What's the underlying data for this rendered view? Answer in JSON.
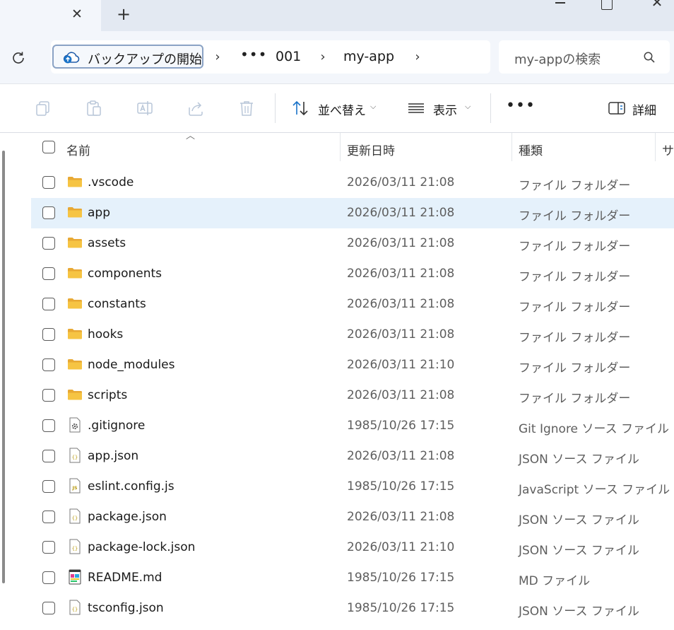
{
  "titlebar": {
    "tab_close_glyph": "✕",
    "new_tab_glyph": "+"
  },
  "address": {
    "root_label": "バックアップの開始",
    "breadcrumb": [
      "001",
      "my-app"
    ],
    "search_placeholder": "my-appの検索"
  },
  "commands": {
    "sort_label": "並べ替え",
    "view_label": "表示",
    "details_label": "詳細",
    "icons": [
      "copy-icon",
      "paste-icon",
      "rename-icon",
      "share-icon",
      "delete-icon"
    ]
  },
  "columns": {
    "name": "名前",
    "date": "更新日時",
    "type": "種類",
    "size": "サイズ"
  },
  "files": [
    {
      "name": ".vscode",
      "date": "2026/03/11 21:08",
      "type": "ファイル フォルダー",
      "icon": "folder-icon"
    },
    {
      "name": "app",
      "date": "2026/03/11 21:08",
      "type": "ファイル フォルダー",
      "icon": "folder-icon",
      "selected": true
    },
    {
      "name": "assets",
      "date": "2026/03/11 21:08",
      "type": "ファイル フォルダー",
      "icon": "folder-icon"
    },
    {
      "name": "components",
      "date": "2026/03/11 21:08",
      "type": "ファイル フォルダー",
      "icon": "folder-icon"
    },
    {
      "name": "constants",
      "date": "2026/03/11 21:08",
      "type": "ファイル フォルダー",
      "icon": "folder-icon"
    },
    {
      "name": "hooks",
      "date": "2026/03/11 21:08",
      "type": "ファイル フォルダー",
      "icon": "folder-icon"
    },
    {
      "name": "node_modules",
      "date": "2026/03/11 21:10",
      "type": "ファイル フォルダー",
      "icon": "folder-icon"
    },
    {
      "name": "scripts",
      "date": "2026/03/11 21:08",
      "type": "ファイル フォルダー",
      "icon": "folder-icon"
    },
    {
      "name": ".gitignore",
      "date": "1985/10/26 17:15",
      "type": "Git Ignore ソース ファイル",
      "icon": "gear-file-icon"
    },
    {
      "name": "app.json",
      "date": "2026/03/11 21:08",
      "type": "JSON ソース ファイル",
      "icon": "json-file-icon"
    },
    {
      "name": "eslint.config.js",
      "date": "1985/10/26 17:15",
      "type": "JavaScript ソース ファイル",
      "icon": "js-file-icon"
    },
    {
      "name": "package.json",
      "date": "2026/03/11 21:08",
      "type": "JSON ソース ファイル",
      "icon": "json-file-icon"
    },
    {
      "name": "package-lock.json",
      "date": "2026/03/11 21:10",
      "type": "JSON ソース ファイル",
      "icon": "json-file-icon"
    },
    {
      "name": "README.md",
      "date": "1985/10/26 17:15",
      "type": "MD ファイル",
      "icon": "markdown-file-icon"
    },
    {
      "name": "tsconfig.json",
      "date": "1985/10/26 17:15",
      "type": "JSON ソース ファイル",
      "icon": "json-file-icon"
    }
  ],
  "colors": {
    "selected_row": "#e5f1fb",
    "folder": "#f6c443",
    "accent": "#1a73c8"
  }
}
